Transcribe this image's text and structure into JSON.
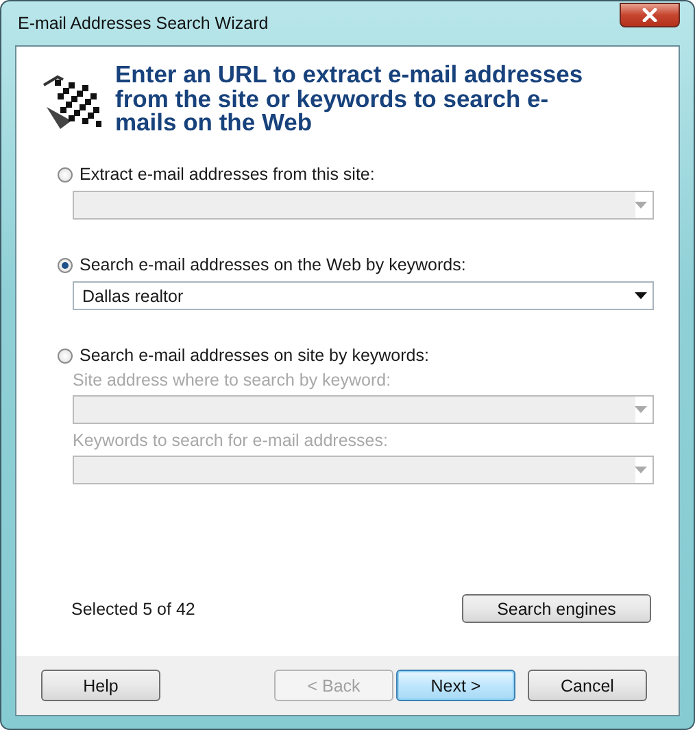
{
  "window": {
    "title": "E-mail Addresses Search Wizard"
  },
  "header": {
    "text": "Enter an URL to extract e-mail addresses from the site or keywords to search e-mails on the Web"
  },
  "options": [
    {
      "label": "Extract e-mail addresses from this site:",
      "selected": false,
      "fields": [
        {
          "disabled": true
        }
      ]
    },
    {
      "label": "Search e-mail addresses on the Web by keywords:",
      "selected": true,
      "fields": [
        {
          "value": "Dallas realtor",
          "disabled": false
        }
      ]
    },
    {
      "label": "Search e-mail addresses on site by keywords:",
      "selected": false,
      "fields": [
        {
          "label": "Site address where to search by keyword:",
          "disabled": true
        },
        {
          "label": "Keywords to search for e-mail addresses:",
          "disabled": true
        }
      ]
    }
  ],
  "status": "Selected 5 of 42",
  "engines_button": {
    "label": "Search engines"
  },
  "buttons": [
    {
      "label": "Help",
      "disabled": false,
      "default": false
    },
    {
      "label": "< Back",
      "disabled": true,
      "default": false
    },
    {
      "label": "Next >",
      "disabled": false,
      "default": true
    },
    {
      "label": "Cancel",
      "disabled": false,
      "default": false
    }
  ]
}
